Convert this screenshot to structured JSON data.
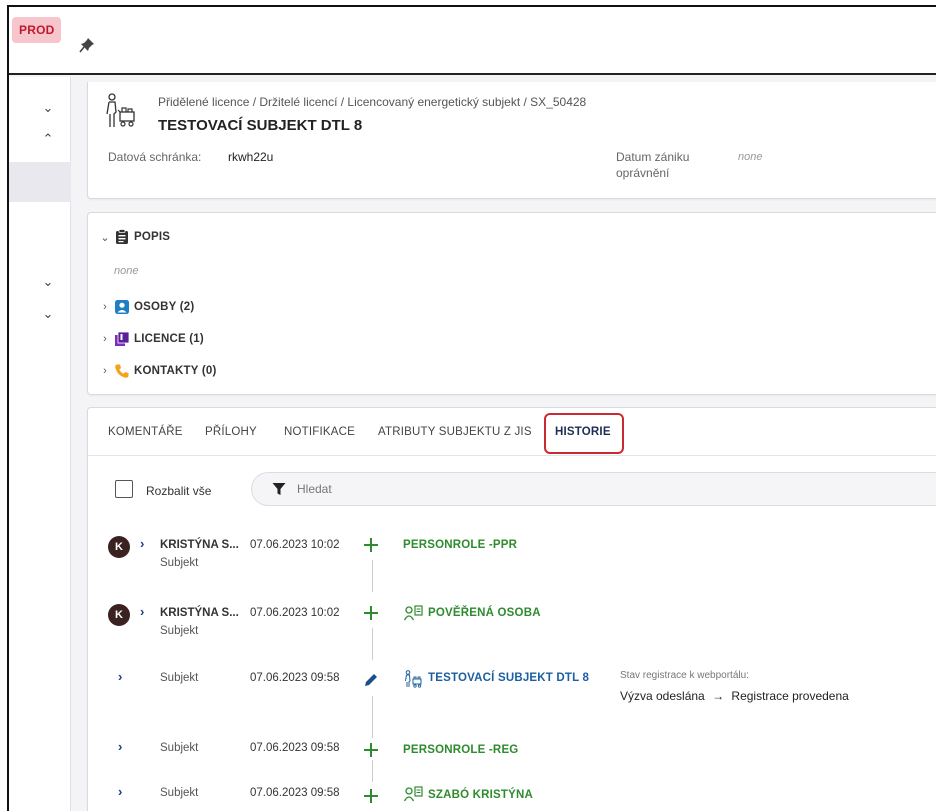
{
  "env_badge": "PROD",
  "header": {
    "breadcrumb": "Přidělené licence / Držitelé licencí / Licencovaný energetický subjekt / SX_50428",
    "title": "TESTOVACÍ SUBJEKT DTL 8"
  },
  "details": {
    "datova_schranka_label": "Datová schránka:",
    "datova_schranka_value": "rkwh22u",
    "datum_zaniku_label_1": "Datum zániku",
    "datum_zaniku_label_2": "oprávnění",
    "datum_zaniku_value": "none"
  },
  "sections": {
    "popis": "POPIS",
    "popis_value": "none",
    "osoby": "OSOBY (2)",
    "licence": "LICENCE (1)",
    "kontakty": "KONTAKTY (0)"
  },
  "tabs": [
    "KOMENTÁŘE",
    "PŘÍLOHY",
    "NOTIFIKACE",
    "ATRIBUTY SUBJEKTU Z JIS",
    "HISTORIE"
  ],
  "history_controls": {
    "expand_all": "Rozbalit vše",
    "search_placeholder": "Hledat"
  },
  "history": [
    {
      "avatar": "K",
      "author": "KRISTÝNA S...",
      "subject": "Subjekt",
      "date": "07.06.2023 10:02",
      "action": "add",
      "entity": "PERSONROLE -PPR",
      "entity_icon": "none"
    },
    {
      "avatar": "K",
      "author": "KRISTÝNA S...",
      "subject": "Subjekt",
      "date": "07.06.2023 10:02",
      "action": "add",
      "entity": "POVĚŘENÁ OSOBA",
      "entity_icon": "person-card-icon"
    },
    {
      "avatar": "",
      "author": "",
      "subject": "Subjekt",
      "date": "07.06.2023 09:58",
      "action": "edit",
      "entity": "TESTOVACÍ SUBJEKT DTL 8",
      "entity_icon": "energy-subject-icon",
      "change_label": "Stav registrace k webportálu:",
      "change_from": "Výzva odeslána",
      "change_arrow": "→",
      "change_to": "Registrace provedena"
    },
    {
      "avatar": "",
      "author": "",
      "subject": "Subjekt",
      "date": "07.06.2023 09:58",
      "action": "add",
      "entity": "PERSONROLE -REG",
      "entity_icon": "none"
    },
    {
      "avatar": "",
      "author": "",
      "subject": "Subjekt",
      "date": "07.06.2023 09:58",
      "action": "add",
      "entity": "SZABÓ KRISTÝNA",
      "entity_icon": "person-card-icon"
    }
  ],
  "colors": {
    "accent_green": "#2e8b2e",
    "accent_blue": "#1b5fa0",
    "highlight_red": "#cc2a32",
    "prod_bg": "#f6c6cc",
    "prod_text": "#c0182b"
  }
}
